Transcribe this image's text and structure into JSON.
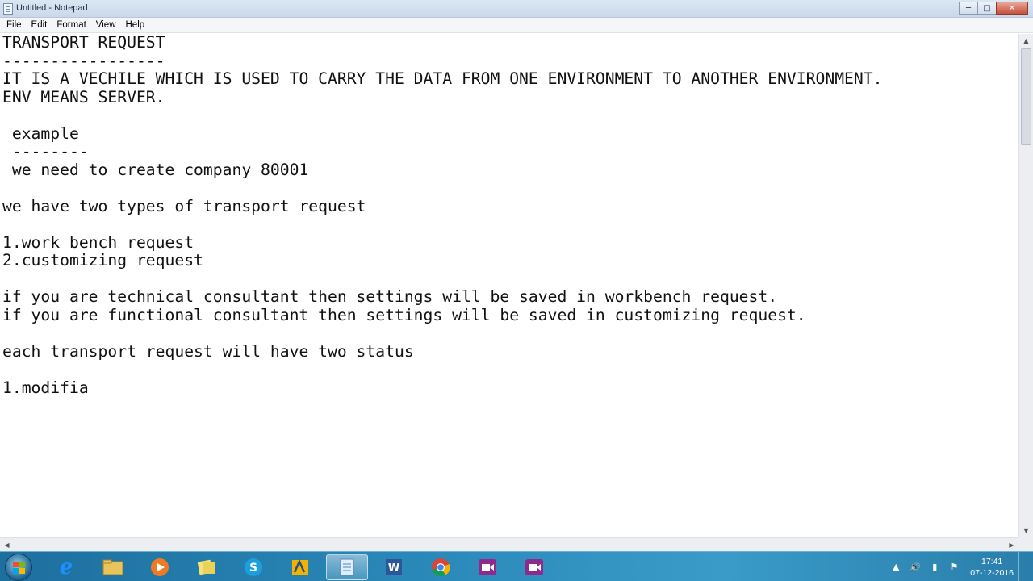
{
  "window": {
    "title": "Untitled - Notepad",
    "min_label": "─",
    "max_label": "□",
    "close_label": "✕"
  },
  "menu": {
    "file": "File",
    "edit": "Edit",
    "format": "Format",
    "view": "View",
    "help": "Help"
  },
  "editor": {
    "lines": [
      "TRANSPORT REQUEST",
      "-----------------",
      "IT IS A VECHILE WHICH IS USED TO CARRY THE DATA FROM ONE ENVIRONMENT TO ANOTHER ENVIRONMENT.",
      "ENV MEANS SERVER.",
      "",
      " example",
      " --------",
      " we need to create company 80001",
      "",
      "we have two types of transport request",
      "",
      "1.work bench request",
      "2.customizing request",
      "",
      "if you are technical consultant then settings will be saved in workbench request.",
      "if you are functional consultant then settings will be saved in customizing request.",
      "",
      "each transport request will have two status",
      "",
      "1.modifia"
    ]
  },
  "taskbar": {
    "clock_time": "17:41",
    "clock_date": "07-12-2016",
    "apps": [
      "internet-explorer",
      "file-explorer",
      "media-player",
      "sticky-notes",
      "skype",
      "sap-logon",
      "notepad",
      "word",
      "chrome",
      "video-call-1",
      "video-call-2"
    ]
  },
  "colors": {
    "taskbar": "#2a88b8",
    "titlebar": "#dbe6f3",
    "close_button": "#c7503b"
  }
}
